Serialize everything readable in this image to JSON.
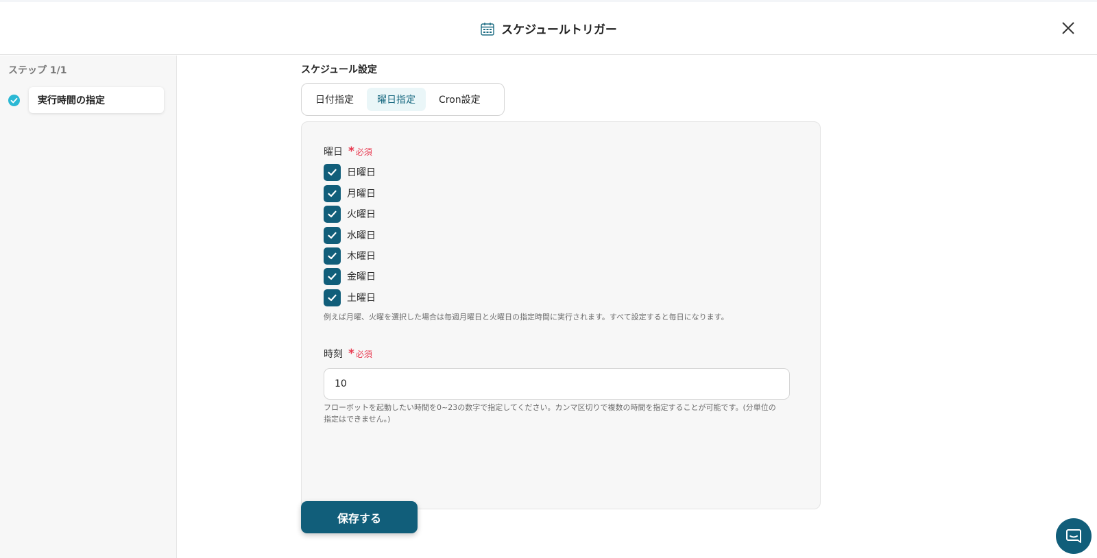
{
  "header": {
    "title": "スケジュールトリガー",
    "icon": "calendar-icon",
    "close_icon": "close-icon"
  },
  "sidebar": {
    "step_label": "ステップ 1/1",
    "steps": [
      {
        "label": "実行時間の指定",
        "status": "completed",
        "icon": "check-circle-icon"
      }
    ]
  },
  "main": {
    "section_title": "スケジュール設定",
    "tabs": [
      {
        "label": "日付指定",
        "active": false
      },
      {
        "label": "曜日指定",
        "active": true
      },
      {
        "label": "Cron設定",
        "active": false
      }
    ],
    "weekday_field": {
      "label": "曜日",
      "required_text": "必須",
      "days": [
        {
          "label": "日曜日",
          "checked": true
        },
        {
          "label": "月曜日",
          "checked": true
        },
        {
          "label": "火曜日",
          "checked": true
        },
        {
          "label": "水曜日",
          "checked": true
        },
        {
          "label": "木曜日",
          "checked": true
        },
        {
          "label": "金曜日",
          "checked": true
        },
        {
          "label": "土曜日",
          "checked": true
        }
      ],
      "hint": "例えば月曜、火曜を選択した場合は毎週月曜日と火曜日の指定時間に実行されます。すべて設定すると毎日になります。"
    },
    "time_field": {
      "label": "時刻",
      "required_text": "必須",
      "value": "10",
      "hint_line1": "フローボットを起動したい時間を0~23の数字で指定してください。カンマ区切りで複数の時間を指定することが可能です。(分単位の",
      "hint_line2": "指定はできません。)"
    },
    "save_label": "保存する"
  },
  "colors": {
    "primary": "#115e7a",
    "required": "#e8384f",
    "step_check": "#2bb8d4",
    "active_tab_bg": "#eaf6f8"
  },
  "chat": {
    "icon": "chat-icon"
  }
}
